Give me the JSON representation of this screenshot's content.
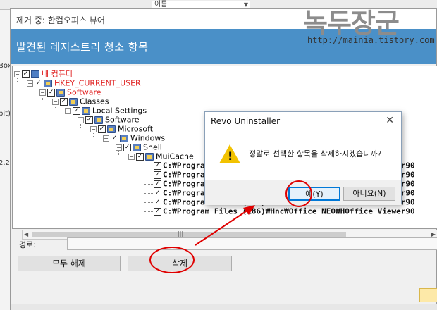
{
  "background": {
    "dropdown_value": "이름",
    "left_fragments": [
      "Box",
      "bit)",
      "2.2"
    ]
  },
  "window": {
    "title": "제거 중: 한컴오피스 뷰어",
    "header": "발견된 레지스트리 청소 항목"
  },
  "tree": [
    {
      "label": "내 컴퓨터",
      "color": "red",
      "icon": "computer-icon"
    },
    {
      "label": "HKEY_CURRENT_USER",
      "color": "red",
      "icon": "folder-icon"
    },
    {
      "label": "Software",
      "color": "red",
      "icon": "folder-icon"
    },
    {
      "label": "Classes",
      "color": "black",
      "icon": "folder-icon"
    },
    {
      "label": "Local Settings",
      "color": "black",
      "icon": "folder-icon"
    },
    {
      "label": "Software",
      "color": "black",
      "icon": "folder-icon"
    },
    {
      "label": "Microsoft",
      "color": "black",
      "icon": "folder-icon"
    },
    {
      "label": "Windows",
      "color": "black",
      "icon": "folder-icon"
    },
    {
      "label": "Shell",
      "color": "black",
      "icon": "folder-icon"
    },
    {
      "label": "MuiCache",
      "color": "black",
      "icon": "folder-icon"
    }
  ],
  "path_items": [
    "C:₩Program Files (x86)₩Hnc₩Office NEO₩HOffice Viewer90",
    "C:₩Program Files (x86)₩Hnc₩Office NEO₩HOffice Viewer90",
    "C:₩Program Files (x86)₩Hnc₩Office NEO₩HOffice Viewer90",
    "C:₩Program Files (x86)₩Hnc₩Office NEO₩HOffice Viewer90",
    "C:₩Program Files (x86)₩Hnc₩Office NEO₩HOffice Viewer90",
    "C:₩Program Files (x86)₩Hnc₩Office NEO₩HOffice Viewer90"
  ],
  "path_label": "경로:",
  "buttons": {
    "release_all": "모두 해제",
    "delete": "삭제"
  },
  "dialog": {
    "title": "Revo Uninstaller",
    "message": "정말로 선택한 항목을 삭제하시겠습니까?",
    "yes": "예(Y)",
    "no": "아니요(N)"
  },
  "watermark": {
    "name": "녹두장군",
    "url": "http://mainia.tistory.com"
  },
  "colors": {
    "header_bg": "#4a90c8",
    "annotation": "#e00000",
    "tree_red": "#e02020"
  }
}
